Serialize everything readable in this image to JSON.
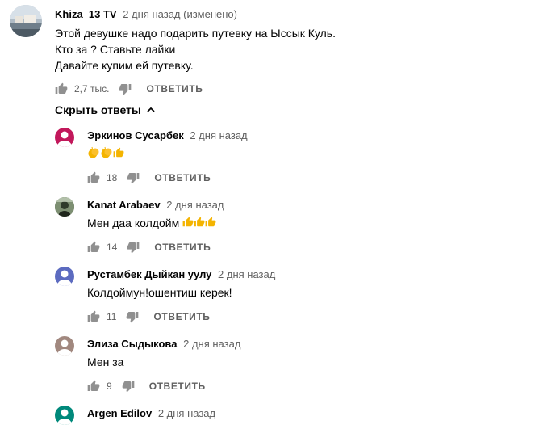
{
  "top_comment": {
    "author": "Khiza_13 TV",
    "time": "2 дня назад (изменено)",
    "lines": [
      "Этой девушке надо подарить путевку на Ыссык Куль.",
      "Кто за ? Ставьте лайки",
      "Давайте купим ей путевку."
    ],
    "likes": "2,7 тыс.",
    "reply_label": "ОТВЕТИТЬ",
    "avatar_icon": "landscape-avatar"
  },
  "replies_toggle": {
    "label": "Скрыть ответы",
    "icon": "chevron-up-icon"
  },
  "replies": [
    {
      "author": "Эркинов Сусарбек",
      "time": "2 дня назад",
      "text": "",
      "emoji": [
        "clapping-hands-icon",
        "clapping-hands-icon",
        "thumbs-up-icon"
      ],
      "likes": "18",
      "reply_label": "ОТВЕТИТЬ",
      "avatar_color": "#c2185b",
      "avatar_icon": "person-avatar"
    },
    {
      "author": "Kanat Arabaev",
      "time": "2 дня назад",
      "text": "Мен даа колдойм",
      "emoji": [
        "thumbs-up-icon",
        "thumbs-up-icon",
        "thumbs-up-icon"
      ],
      "likes": "14",
      "reply_label": "ОТВЕТИТЬ",
      "avatar_color": "#4b5a44",
      "avatar_icon": "photo-avatar"
    },
    {
      "author": "Рустамбек Дыйкан уулу",
      "time": "2 дня назад",
      "text": "Колдоймун!ошентиш керек!",
      "emoji": [],
      "likes": "11",
      "reply_label": "ОТВЕТИТЬ",
      "avatar_color": "#5c6bc0",
      "avatar_icon": "person-avatar"
    },
    {
      "author": "Элиза Сыдыкова",
      "time": "2 дня назад",
      "text": "Мен за",
      "emoji": [],
      "likes": "9",
      "reply_label": "ОТВЕТИТЬ",
      "avatar_color": "#a1887f",
      "avatar_icon": "person-avatar"
    },
    {
      "author": "Argen Edilov",
      "time": "2 дня назад",
      "text": "",
      "emoji": [],
      "likes": "",
      "reply_label": "",
      "avatar_color": "#00897b",
      "avatar_icon": "person-avatar"
    }
  ],
  "colors": {
    "text": "#030303",
    "secondary": "#606060",
    "icon": "#909090",
    "emoji": "#f4b400"
  }
}
